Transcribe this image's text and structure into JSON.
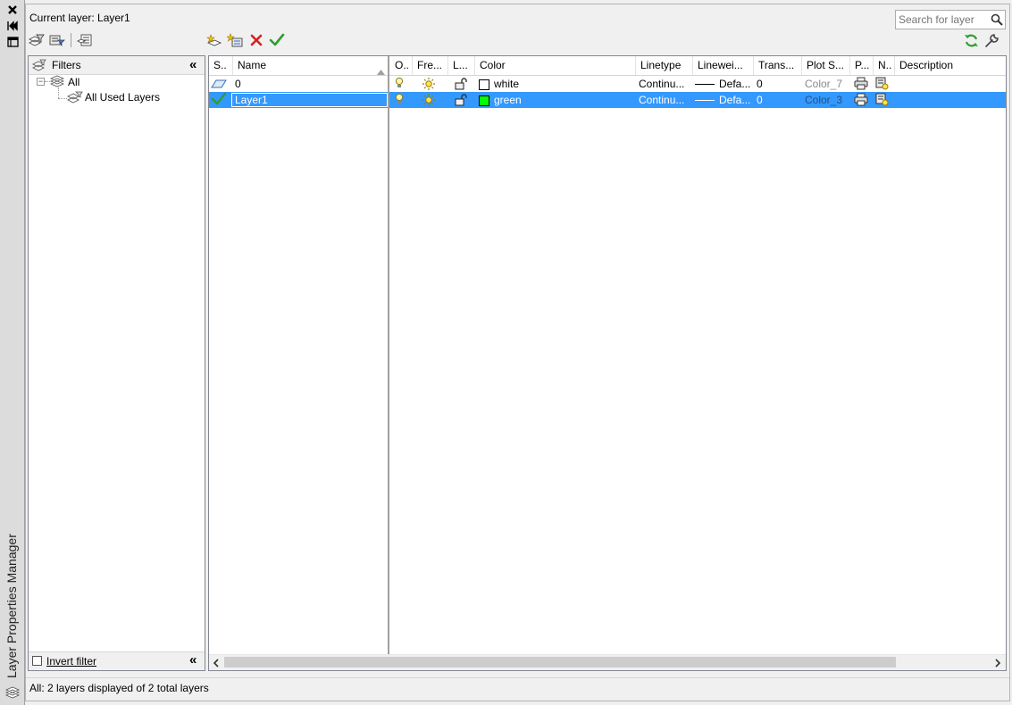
{
  "palette": {
    "vertical_title": "Layer Properties Manager",
    "buttons": [
      "close-icon",
      "auto-hide-icon",
      "properties-icon"
    ]
  },
  "header": {
    "current_layer_label": "Current layer: Layer1"
  },
  "search": {
    "placeholder": "Search for layer"
  },
  "filters_panel": {
    "title": "Filters",
    "tree": [
      {
        "label": "All"
      },
      {
        "label": "All Used Layers"
      }
    ],
    "invert_filter_label": "Invert filter",
    "invert_filter_checked": false
  },
  "columns": {
    "status": "S..",
    "name": "Name",
    "on": "O..",
    "freeze": "Fre...",
    "lock": "L...",
    "color": "Color",
    "linetype": "Linetype",
    "lineweight": "Linewei...",
    "transparency": "Trans...",
    "plot_style": "Plot S...",
    "plot": "P...",
    "new_vp_freeze": "N..",
    "description": "Description"
  },
  "layers": [
    {
      "status_icon": "layer-icon",
      "name": "0",
      "color_name": "white",
      "color_hex": "#ffffff",
      "linetype": "Continu...",
      "lineweight": "Defa...",
      "transparency": "0",
      "plot_style": "Color_7",
      "selected": false
    },
    {
      "status_icon": "current-check-icon",
      "name": "Layer1",
      "color_name": "green",
      "color_hex": "#00ff00",
      "linetype": "Continu...",
      "lineweight": "Defa...",
      "transparency": "0",
      "plot_style": "Color_3",
      "selected": true
    }
  ],
  "status_bar": {
    "text": "All: 2 layers displayed of 2 total layers"
  },
  "colors": {
    "selection": "#3399ff",
    "check_green": "#2e9e2e",
    "delete_red": "#d62020"
  }
}
